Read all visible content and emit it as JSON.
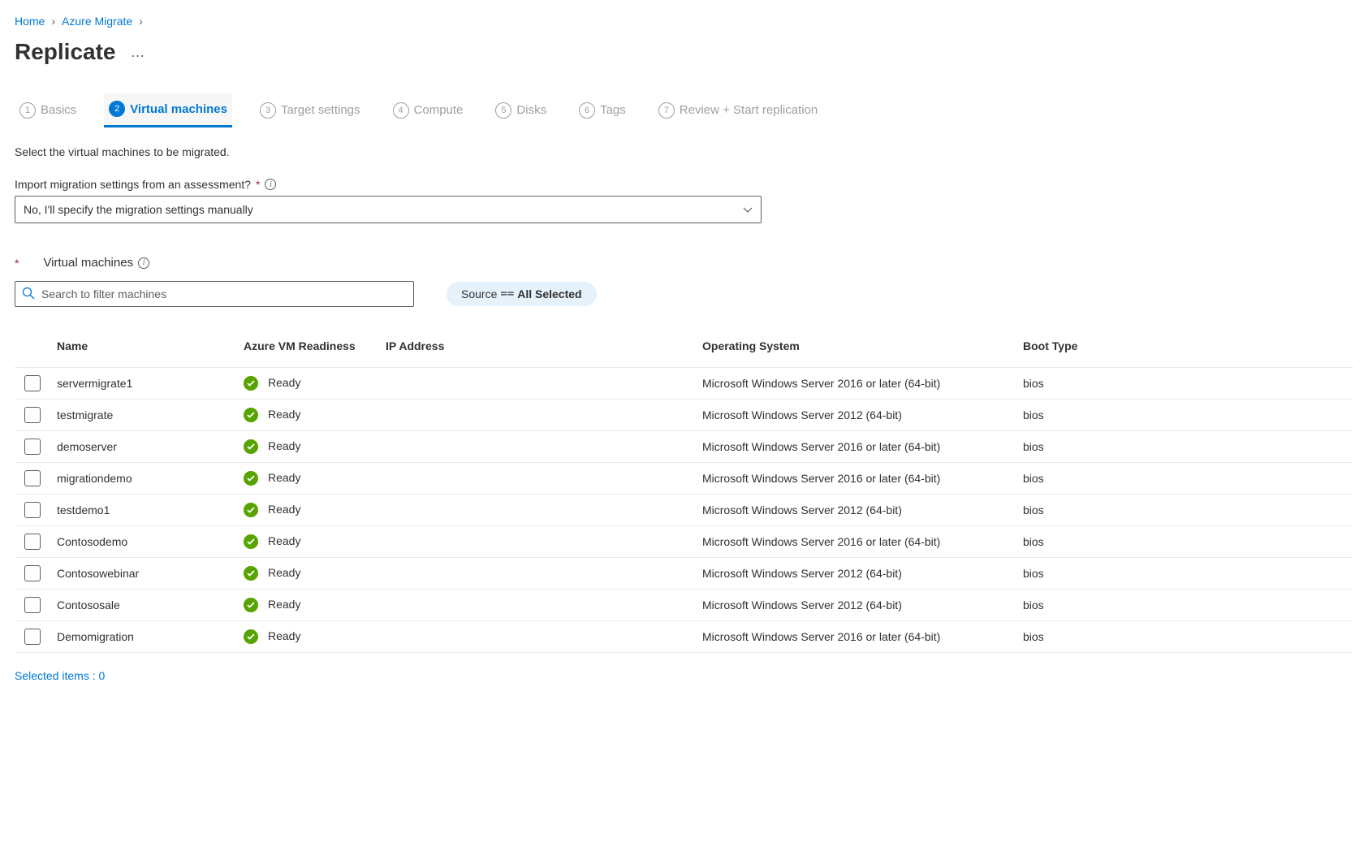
{
  "breadcrumb": {
    "items": [
      {
        "label": "Home"
      },
      {
        "label": "Azure Migrate"
      }
    ]
  },
  "page": {
    "title": "Replicate"
  },
  "tabs": [
    {
      "step": "1",
      "label": "Basics"
    },
    {
      "step": "2",
      "label": "Virtual machines"
    },
    {
      "step": "3",
      "label": "Target settings"
    },
    {
      "step": "4",
      "label": "Compute"
    },
    {
      "step": "5",
      "label": "Disks"
    },
    {
      "step": "6",
      "label": "Tags"
    },
    {
      "step": "7",
      "label": "Review + Start replication"
    }
  ],
  "description": "Select the virtual machines to be migrated.",
  "import_field": {
    "label": "Import migration settings from an assessment?",
    "value": "No, I'll specify the migration settings manually"
  },
  "vm_section": {
    "label": "Virtual machines",
    "search_placeholder": "Search to filter machines",
    "filter_pill": {
      "key": "Source",
      "operator": "==",
      "value": "All Selected"
    }
  },
  "table": {
    "headers": {
      "name": "Name",
      "readiness": "Azure VM Readiness",
      "ip": "IP Address",
      "os": "Operating System",
      "boot": "Boot Type"
    },
    "rows": [
      {
        "name": "servermigrate1",
        "readiness": "Ready",
        "ip": "",
        "os": "Microsoft Windows Server 2016 or later (64-bit)",
        "boot": "bios"
      },
      {
        "name": "testmigrate",
        "readiness": "Ready",
        "ip": "",
        "os": "Microsoft Windows Server 2012 (64-bit)",
        "boot": "bios"
      },
      {
        "name": "demoserver",
        "readiness": "Ready",
        "ip": "",
        "os": "Microsoft Windows Server 2016 or later (64-bit)",
        "boot": "bios"
      },
      {
        "name": "migrationdemo",
        "readiness": "Ready",
        "ip": "",
        "os": "Microsoft Windows Server 2016 or later (64-bit)",
        "boot": "bios"
      },
      {
        "name": "testdemo1",
        "readiness": "Ready",
        "ip": "",
        "os": "Microsoft Windows Server 2012 (64-bit)",
        "boot": "bios"
      },
      {
        "name": "Contosodemo",
        "readiness": "Ready",
        "ip": "",
        "os": "Microsoft Windows Server 2016 or later (64-bit)",
        "boot": "bios"
      },
      {
        "name": "Contosowebinar",
        "readiness": "Ready",
        "ip": "",
        "os": "Microsoft Windows Server 2012 (64-bit)",
        "boot": "bios"
      },
      {
        "name": "Contososale",
        "readiness": "Ready",
        "ip": "",
        "os": "Microsoft Windows Server 2012 (64-bit)",
        "boot": "bios"
      },
      {
        "name": "Demomigration",
        "readiness": "Ready",
        "ip": "",
        "os": "Microsoft Windows Server 2016 or later (64-bit)",
        "boot": "bios"
      }
    ]
  },
  "footer": {
    "selected_label": "Selected items : 0"
  }
}
